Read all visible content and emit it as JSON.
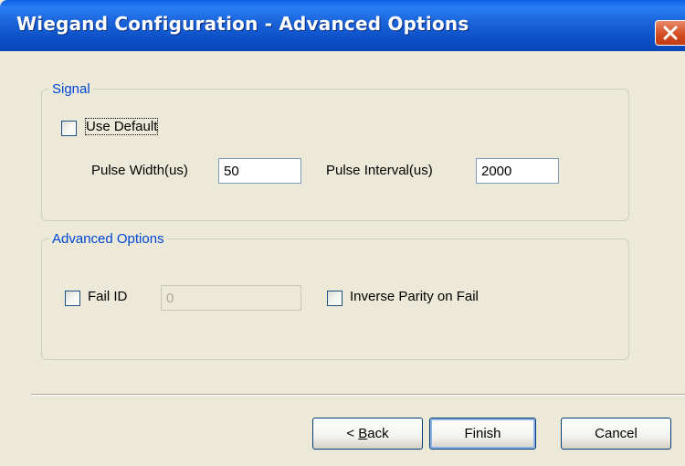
{
  "window": {
    "title": "Wiegand Configuration - Advanced Options"
  },
  "signal": {
    "group_label": "Signal",
    "use_default_label": "Use Default",
    "use_default_checked": false,
    "pulse_width_label": "Pulse Width(us)",
    "pulse_width_value": "50",
    "pulse_interval_label": "Pulse Interval(us)",
    "pulse_interval_value": "2000"
  },
  "advanced": {
    "group_label": "Advanced Options",
    "fail_id_label": "Fail ID",
    "fail_id_checked": false,
    "fail_id_value": "0",
    "inverse_parity_label": "Inverse Parity on Fail",
    "inverse_parity_checked": false
  },
  "buttons": {
    "back_prefix": "< ",
    "back_mnemonic": "B",
    "back_rest": "ack",
    "finish": "Finish",
    "cancel": "Cancel"
  },
  "icons": {
    "close": "close-icon"
  },
  "colors": {
    "titlebar": "#0a5fe0",
    "group_label": "#0046d5",
    "dialog_bg": "#ece9d8",
    "close_button": "#d04a1f"
  }
}
